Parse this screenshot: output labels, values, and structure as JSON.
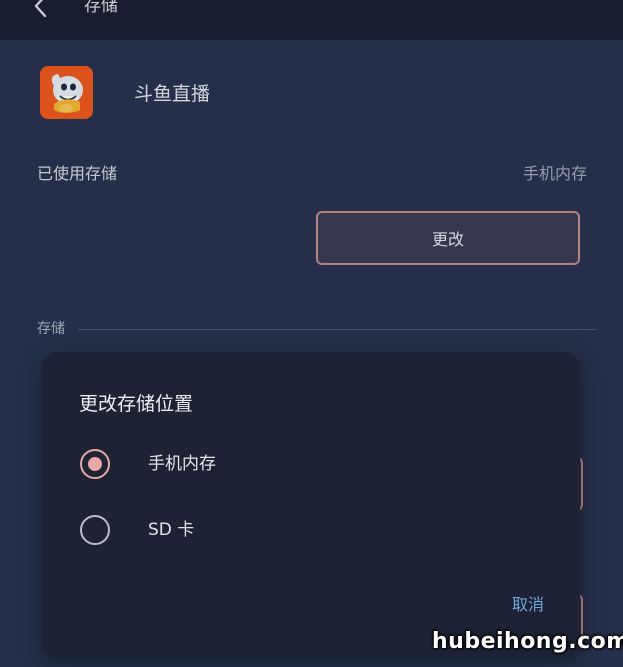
{
  "appbar": {
    "title": "存储",
    "back_icon": "chevron-left-icon"
  },
  "app": {
    "name": "斗鱼直播",
    "icon": "douyu-shark-logo-icon",
    "icon_color": "#ef5a1f"
  },
  "storage_used": {
    "label": "已使用存储",
    "value": "手机内存",
    "change_label": "更改"
  },
  "section": {
    "label": "存储"
  },
  "dialog": {
    "title": "更改存储位置",
    "options": [
      {
        "label": "手机内存",
        "selected": true
      },
      {
        "label": "SD 卡",
        "selected": false
      }
    ],
    "cancel_label": "取消"
  },
  "colors": {
    "background": "#293450",
    "appbar": "#1b2134",
    "dialog": "#1d2335",
    "accent_radio": "#e9a7a4",
    "accent_link": "#6fa8dc",
    "button_border": "#c48d8f"
  },
  "watermark": "hubeihong.com"
}
